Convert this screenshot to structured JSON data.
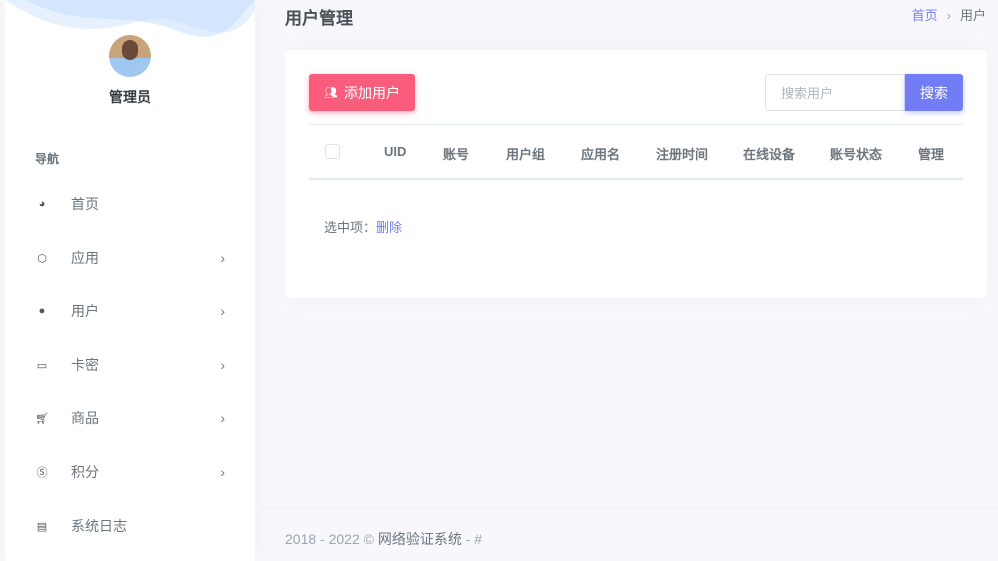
{
  "sidebar": {
    "username": "管理员",
    "nav_header": "导航",
    "items": [
      {
        "label": "首页",
        "icon": "dashboard-icon",
        "chevron": false
      },
      {
        "label": "应用",
        "icon": "cube-icon",
        "chevron": true
      },
      {
        "label": "用户",
        "icon": "user-icon",
        "chevron": true
      },
      {
        "label": "卡密",
        "icon": "card-icon",
        "chevron": true
      },
      {
        "label": "商品",
        "icon": "cart-icon",
        "chevron": true
      },
      {
        "label": "积分",
        "icon": "coin-icon",
        "chevron": true
      },
      {
        "label": "系统日志",
        "icon": "log-icon",
        "chevron": false
      }
    ]
  },
  "header": {
    "title": "用户管理",
    "breadcrumb": [
      "首页",
      "用户"
    ],
    "sep": "›"
  },
  "toolbar": {
    "add_label": "添加用户",
    "search_placeholder": "搜索用户",
    "search_label": "搜索"
  },
  "table": {
    "columns": [
      "UID",
      "账号",
      "用户组",
      "应用名",
      "注册时间",
      "在线设备",
      "账号状态",
      "管理"
    ]
  },
  "selection": {
    "label": "选中项：",
    "delete": "删除"
  },
  "footer": {
    "years": "2018 - 2022 ©",
    "name": "网络验证系统",
    "suffix": "- #"
  },
  "colors": {
    "primary": "#727cf5",
    "danger": "#fa5c7c"
  }
}
